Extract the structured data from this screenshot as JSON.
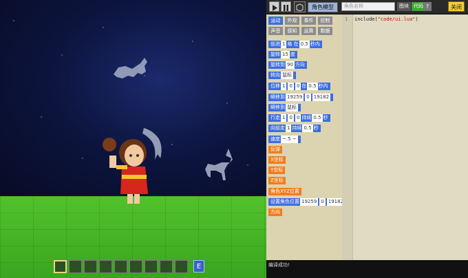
{
  "toolbar": {
    "model_label": "角色模型",
    "name_placeholder": "角色名称",
    "tab_blocks": "图块",
    "tab_code": "代码",
    "help_label": "?",
    "close_label": "关闭"
  },
  "categories": [
    "运动",
    "外观",
    "事件",
    "控制",
    "声音",
    "感知",
    "运算",
    "数据"
  ],
  "blocks": [
    {
      "parts": [
        "前进",
        "1",
        "格 在",
        "0.5",
        "秒内"
      ]
    },
    {
      "parts": [
        "旋转",
        "15",
        "度"
      ]
    },
    {
      "parts": [
        "旋转到",
        "90",
        "方向"
      ]
    },
    {
      "parts": [
        "转向",
        "鼠标"
      ]
    },
    {
      "parts": [
        "位移",
        "1",
        "0",
        "0",
        "在",
        "0.5",
        "秒内"
      ]
    },
    {
      "parts": [
        "瞬移到",
        "19259",
        "0",
        "19182"
      ]
    },
    {
      "parts": [
        "瞬移到",
        "鼠标"
      ]
    },
    {
      "parts": [
        "行走",
        "1",
        "0",
        "0",
        "持续",
        "0.5",
        "秒"
      ]
    },
    {
      "parts": [
        "向前走",
        "1",
        "持续",
        "0.5",
        "秒"
      ]
    },
    {
      "parts": [
        "速度",
        "~.5 ~"
      ]
    },
    {
      "parts": [
        "反弹"
      ]
    },
    {
      "parts": [
        "X坐标"
      ]
    },
    {
      "parts": [
        "Y坐标"
      ]
    },
    {
      "parts": [
        "Z坐标"
      ]
    },
    {
      "parts": [
        "角色XYZ位置"
      ]
    },
    {
      "parts": [
        "设置角色位置",
        "19259",
        "0",
        "19182"
      ]
    },
    {
      "parts": [
        "方向"
      ]
    }
  ],
  "editor": {
    "line_number": "1",
    "code_prefix": "include(",
    "code_string": "\"code/ui.lua\"",
    "code_suffix": ")"
  },
  "status": {
    "message": "编译成功!"
  },
  "hotbar": {
    "key_label": "E",
    "slots": 9
  },
  "colors": {
    "blue_block": "#3d6ee0",
    "orange_block": "#f07d1b",
    "panel_bg": "#dcd3b0",
    "sky": "#0d1540",
    "ground": "#52c22b"
  }
}
